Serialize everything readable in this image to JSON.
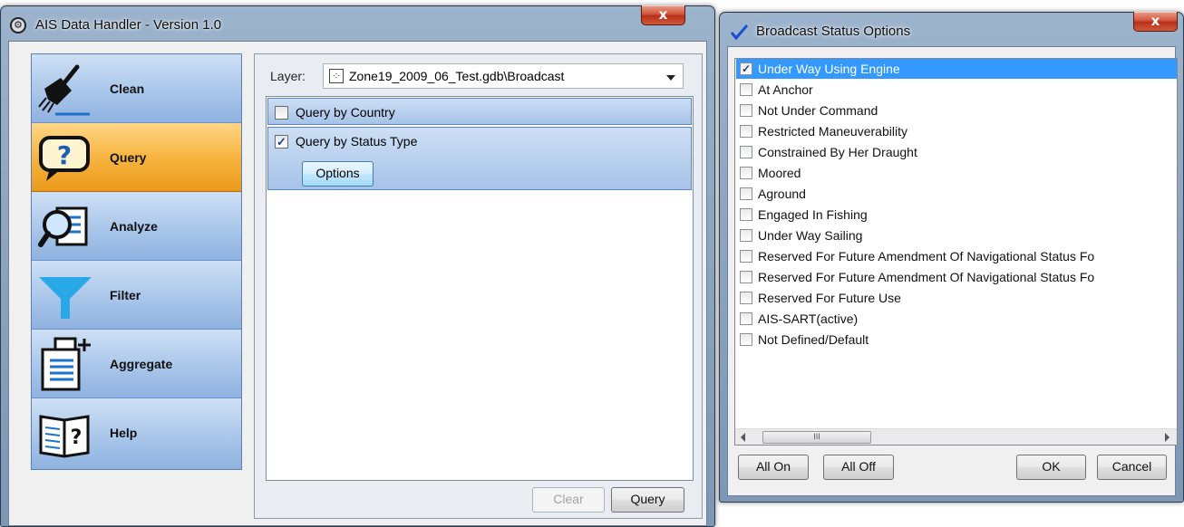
{
  "main_window": {
    "title": "AIS Data Handler - Version 1.0",
    "close_label": "x",
    "sidebar": {
      "items": [
        {
          "label": "Clean",
          "icon": "broom-icon",
          "active": false
        },
        {
          "label": "Query",
          "icon": "question-speech-bubble-icon",
          "active": true
        },
        {
          "label": "Analyze",
          "icon": "magnifier-document-icon",
          "active": false
        },
        {
          "label": "Filter",
          "icon": "funnel-icon",
          "active": false
        },
        {
          "label": "Aggregate",
          "icon": "documents-add-icon",
          "active": false
        },
        {
          "label": "Help",
          "icon": "help-book-icon",
          "active": false
        }
      ]
    },
    "layer": {
      "label": "Layer:",
      "value": "Zone19_2009_06_Test.gdb\\Broadcast"
    },
    "queries": [
      {
        "label": "Query by Country",
        "checked": false
      },
      {
        "label": "Query by Status Type",
        "checked": true,
        "options_label": "Options"
      }
    ],
    "buttons": {
      "clear": "Clear",
      "query": "Query"
    }
  },
  "status_window": {
    "title": "Broadcast Status Options",
    "close_label": "x",
    "items": [
      {
        "label": "Under Way Using Engine",
        "checked": true,
        "selected": true
      },
      {
        "label": "At Anchor",
        "checked": false
      },
      {
        "label": "Not Under Command",
        "checked": false
      },
      {
        "label": "Restricted Maneuverability",
        "checked": false
      },
      {
        "label": "Constrained By Her Draught",
        "checked": false
      },
      {
        "label": "Moored",
        "checked": false
      },
      {
        "label": "Aground",
        "checked": false
      },
      {
        "label": "Engaged In Fishing",
        "checked": false
      },
      {
        "label": "Under Way Sailing",
        "checked": false
      },
      {
        "label": "Reserved For Future Amendment Of Navigational Status Fo",
        "checked": false
      },
      {
        "label": "Reserved For Future Amendment Of Navigational Status Fo",
        "checked": false
      },
      {
        "label": "Reserved For Future Use",
        "checked": false
      },
      {
        "label": "AIS-SART(active)",
        "checked": false
      },
      {
        "label": "Not Defined/Default",
        "checked": false
      }
    ],
    "scroll_thumb": "III",
    "buttons": {
      "all_on": "All On",
      "all_off": "All Off",
      "ok": "OK",
      "cancel": "Cancel"
    }
  }
}
